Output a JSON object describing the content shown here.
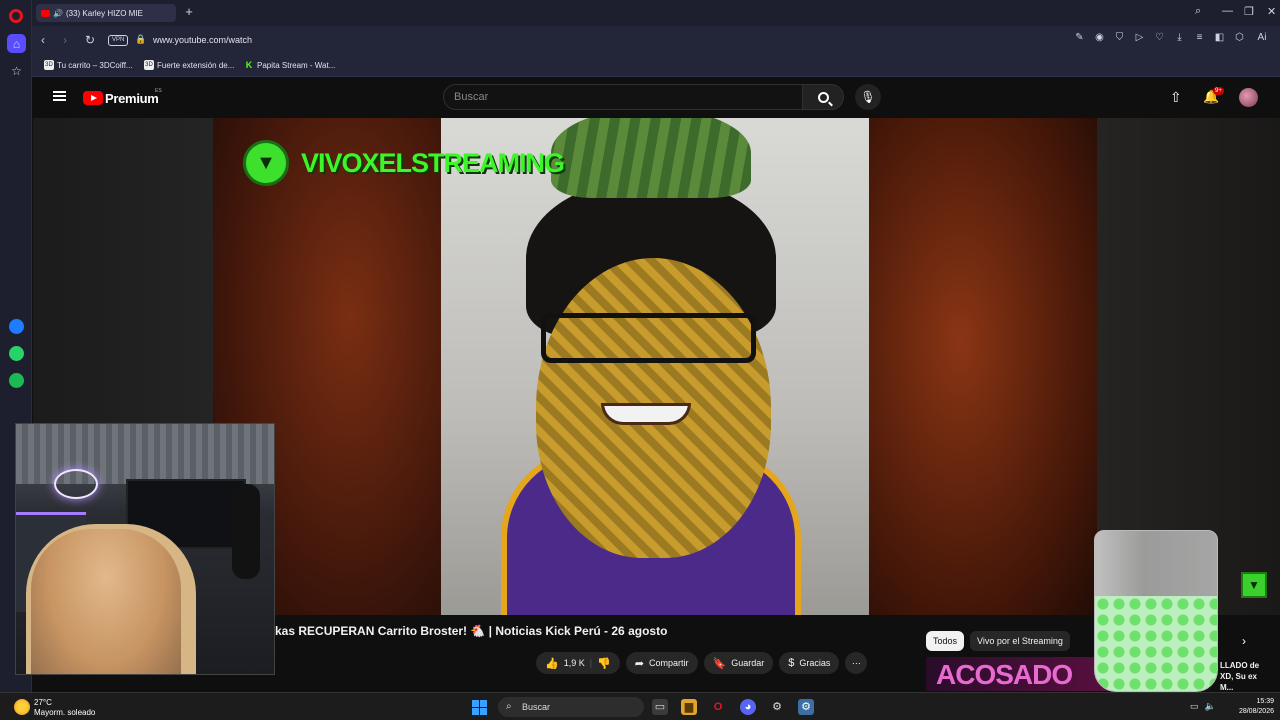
{
  "browser": {
    "tab_title": "(33) Karley HIZO MIE",
    "new_tab_symbol": "+",
    "url": "www.youtube.com/watch",
    "vpn_label": "VPN",
    "ai_label": "Ai",
    "bookmarks": [
      {
        "label": "Tu carrito – 3DCoiff...",
        "icon": "3D"
      },
      {
        "label": "Fuerte extensión de...",
        "icon": "3D"
      },
      {
        "label": "Papita Stream - Wat...",
        "icon": "K"
      }
    ]
  },
  "youtube": {
    "brand": "Premium",
    "region": "ES",
    "search_placeholder": "Buscar",
    "notifications_badge": "9+",
    "video_title": "kas RECUPERAN Carrito Broster! 🐔 | Noticias Kick Perú - 26 agosto",
    "channel_overlay": "VIVOXELSTREAMING",
    "likes": "1,9 K",
    "actions": {
      "share": "Compartir",
      "save": "Guardar",
      "thanks": "Gracias"
    },
    "chips": [
      "Todos",
      "Vivo por el Streaming"
    ],
    "promo_text": "ACOSADO",
    "side_snippet": [
      "LLADO de",
      "XD, Su ex",
      "M..."
    ]
  },
  "taskbar": {
    "temperature": "27°C",
    "weather": "Mayorm. soleado",
    "search_label": "Buscar",
    "time": "15:39",
    "date": "28/08/2026"
  },
  "colors": {
    "yt_red": "#ff0000",
    "neon_green": "#3ef52a",
    "opera_red": "#e8141f"
  }
}
